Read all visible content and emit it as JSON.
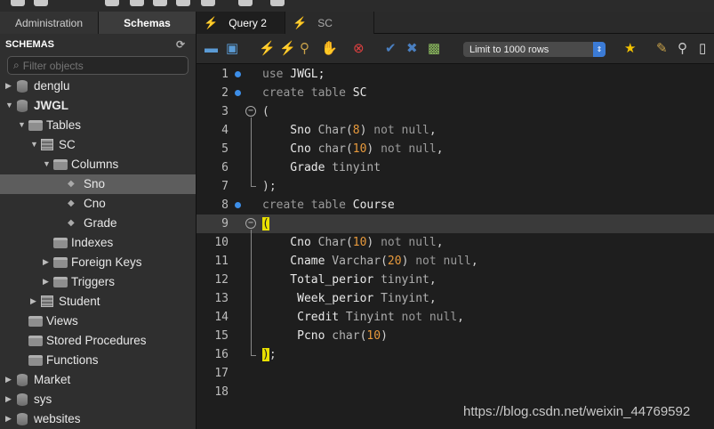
{
  "tabs": [
    {
      "label": "Administration"
    },
    {
      "label": "Schemas"
    },
    {
      "label": "Query 2"
    },
    {
      "label": "SC"
    }
  ],
  "sidebar": {
    "title": "SCHEMAS",
    "filter_placeholder": "Filter objects",
    "tree": [
      {
        "label": "denglu"
      },
      {
        "label": "JWGL"
      },
      {
        "label": "Tables"
      },
      {
        "label": "SC"
      },
      {
        "label": "Columns"
      },
      {
        "label": "Sno"
      },
      {
        "label": "Cno"
      },
      {
        "label": "Grade"
      },
      {
        "label": "Indexes"
      },
      {
        "label": "Foreign Keys"
      },
      {
        "label": "Triggers"
      },
      {
        "label": "Student"
      },
      {
        "label": "Views"
      },
      {
        "label": "Stored Procedures"
      },
      {
        "label": "Functions"
      },
      {
        "label": "Market"
      },
      {
        "label": "sys"
      },
      {
        "label": "websites"
      }
    ]
  },
  "toolbar": {
    "limit_select": "Limit to 1000 rows",
    "icons": [
      "open-file-icon",
      "save-icon",
      "execute-icon",
      "execute-current-icon",
      "explain-icon",
      "stop-icon",
      "toggle-error-icon",
      "commit-icon",
      "rollback-icon",
      "autocommit-icon",
      "add-snippet-icon",
      "beautify-icon",
      "find-icon",
      "toggle-panel-icon"
    ]
  },
  "editor": {
    "line_numbers": [
      "1",
      "2",
      "3",
      "4",
      "5",
      "6",
      "7",
      "8",
      "9",
      "10",
      "11",
      "12",
      "13",
      "14",
      "15",
      "16",
      "17",
      "18"
    ],
    "lines": [
      [
        {
          "t": "kw",
          "v": "use"
        },
        {
          "t": "id",
          "v": " JWGL;"
        }
      ],
      [
        {
          "t": "kw",
          "v": "create table"
        },
        {
          "t": "id",
          "v": " SC"
        }
      ],
      [
        {
          "t": "pu",
          "v": "("
        }
      ],
      [
        {
          "t": "id",
          "v": "    Sno "
        },
        {
          "t": "ty",
          "v": "Char"
        },
        {
          "t": "pu",
          "v": "("
        },
        {
          "t": "num",
          "v": "8"
        },
        {
          "t": "pu",
          "v": ")"
        },
        {
          "t": "kw",
          "v": " not null"
        },
        {
          "t": "pu",
          "v": ","
        }
      ],
      [
        {
          "t": "id",
          "v": "    Cno "
        },
        {
          "t": "ty",
          "v": "char"
        },
        {
          "t": "pu",
          "v": "("
        },
        {
          "t": "num",
          "v": "10"
        },
        {
          "t": "pu",
          "v": ")"
        },
        {
          "t": "kw",
          "v": " not null"
        },
        {
          "t": "pu",
          "v": ","
        }
      ],
      [
        {
          "t": "id",
          "v": "    Grade "
        },
        {
          "t": "ty",
          "v": "tinyint"
        }
      ],
      [
        {
          "t": "pu",
          "v": ");"
        }
      ],
      [
        {
          "t": "kw",
          "v": "create table"
        },
        {
          "t": "id",
          "v": " Course"
        }
      ],
      [
        {
          "t": "hl",
          "v": "("
        }
      ],
      [
        {
          "t": "id",
          "v": "    Cno "
        },
        {
          "t": "ty",
          "v": "Char"
        },
        {
          "t": "pu",
          "v": "("
        },
        {
          "t": "num",
          "v": "10"
        },
        {
          "t": "pu",
          "v": ")"
        },
        {
          "t": "kw",
          "v": " not null"
        },
        {
          "t": "pu",
          "v": ","
        }
      ],
      [
        {
          "t": "id",
          "v": "    Cname "
        },
        {
          "t": "ty",
          "v": "Varchar"
        },
        {
          "t": "pu",
          "v": "("
        },
        {
          "t": "num",
          "v": "20"
        },
        {
          "t": "pu",
          "v": ")"
        },
        {
          "t": "kw",
          "v": " not null"
        },
        {
          "t": "pu",
          "v": ","
        }
      ],
      [
        {
          "t": "id",
          "v": "    Total_perior "
        },
        {
          "t": "ty",
          "v": "tinyint"
        },
        {
          "t": "pu",
          "v": ","
        }
      ],
      [
        {
          "t": "id",
          "v": "     Week_perior "
        },
        {
          "t": "ty",
          "v": "Tinyint"
        },
        {
          "t": "pu",
          "v": ","
        }
      ],
      [
        {
          "t": "id",
          "v": "     Credit "
        },
        {
          "t": "ty",
          "v": "Tinyint"
        },
        {
          "t": "kw",
          "v": " not null"
        },
        {
          "t": "pu",
          "v": ","
        }
      ],
      [
        {
          "t": "id",
          "v": "     Pcno "
        },
        {
          "t": "ty",
          "v": "char"
        },
        {
          "t": "pu",
          "v": "("
        },
        {
          "t": "num",
          "v": "10"
        },
        {
          "t": "pu",
          "v": ")"
        }
      ],
      [
        {
          "t": "hl",
          "v": ")"
        },
        {
          "t": "pu",
          "v": ";"
        }
      ],
      [],
      []
    ]
  },
  "watermark": "https://blog.csdn.net/weixin_44769592"
}
